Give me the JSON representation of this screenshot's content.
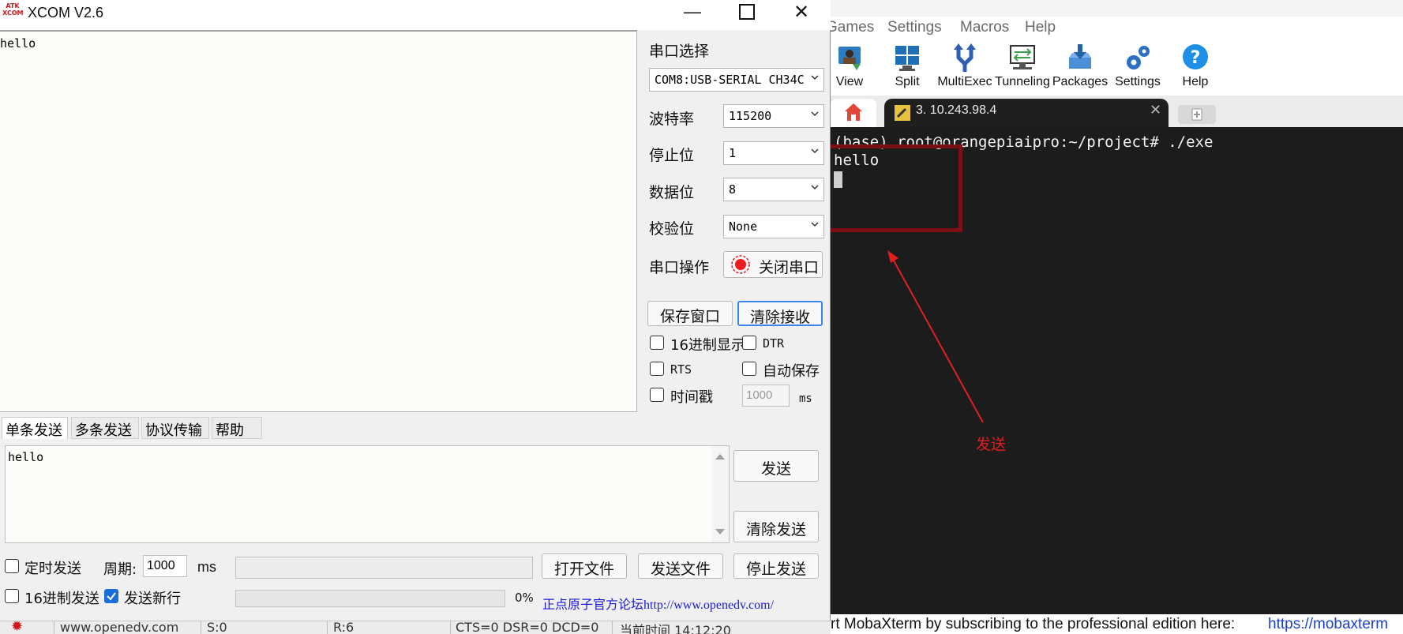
{
  "xcom": {
    "title": "XCOM V2.6",
    "logo_text": "ATK XCOM",
    "receive_text": "hello",
    "port_label": "串口选择",
    "port_value": "COM8:USB-SERIAL CH34C",
    "baud_label": "波特率",
    "baud_value": "115200",
    "stop_label": "停止位",
    "stop_value": "1",
    "data_label": "数据位",
    "data_value": "8",
    "parity_label": "校验位",
    "parity_value": "None",
    "op_label": "串口操作",
    "op_button": "关闭串口",
    "save_window": "保存窗口",
    "clear_receive": "清除接收",
    "hex_display": "16进制显示",
    "dtr": "DTR",
    "rts": "RTS",
    "auto_save": "自动保存",
    "timestamp": "时间戳",
    "timestamp_value": "1000",
    "ms": "ms",
    "tabs": [
      "单条发送",
      "多条发送",
      "协议传输",
      "帮助"
    ],
    "send_text": "hello",
    "send_button": "发送",
    "clear_send": "清除发送",
    "timed_send": "定时发送",
    "period_label": "周期:",
    "period_value": "1000",
    "period_unit": "ms",
    "open_file": "打开文件",
    "send_file": "发送文件",
    "stop_send": "停止发送",
    "hex_send": "16进制发送",
    "send_newline": "发送新行",
    "progress": "0%",
    "forum_link": "正点原子官方论坛http://www.openedv.com/",
    "status": [
      "www.openedv.com",
      "S:0",
      "R:6",
      "CTS=0 DSR=0 DCD=0",
      "当前时间 14:12:20"
    ],
    "checked": {
      "hex_display": false,
      "dtr": false,
      "rts": false,
      "auto_save": false,
      "timestamp": false,
      "timed_send": false,
      "hex_send": false,
      "send_newline": true
    }
  },
  "moba": {
    "menu": [
      "Games",
      "Settings",
      "Macros",
      "Help"
    ],
    "toolbar": [
      "View",
      "Split",
      "MultiExec",
      "Tunneling",
      "Packages",
      "Settings",
      "Help"
    ],
    "tab_title": "3. 10.243.98.4",
    "terminal_lines": [
      "(base) root@orangepiaipro:~/project# ./exe",
      "hello"
    ],
    "status_text": "rt MobaXterm by subscribing to the professional edition here:",
    "status_link": "https://mobaxterm"
  },
  "annotation": {
    "label": "发送",
    "color": "#e02020",
    "box_color": "#7a0f14"
  }
}
